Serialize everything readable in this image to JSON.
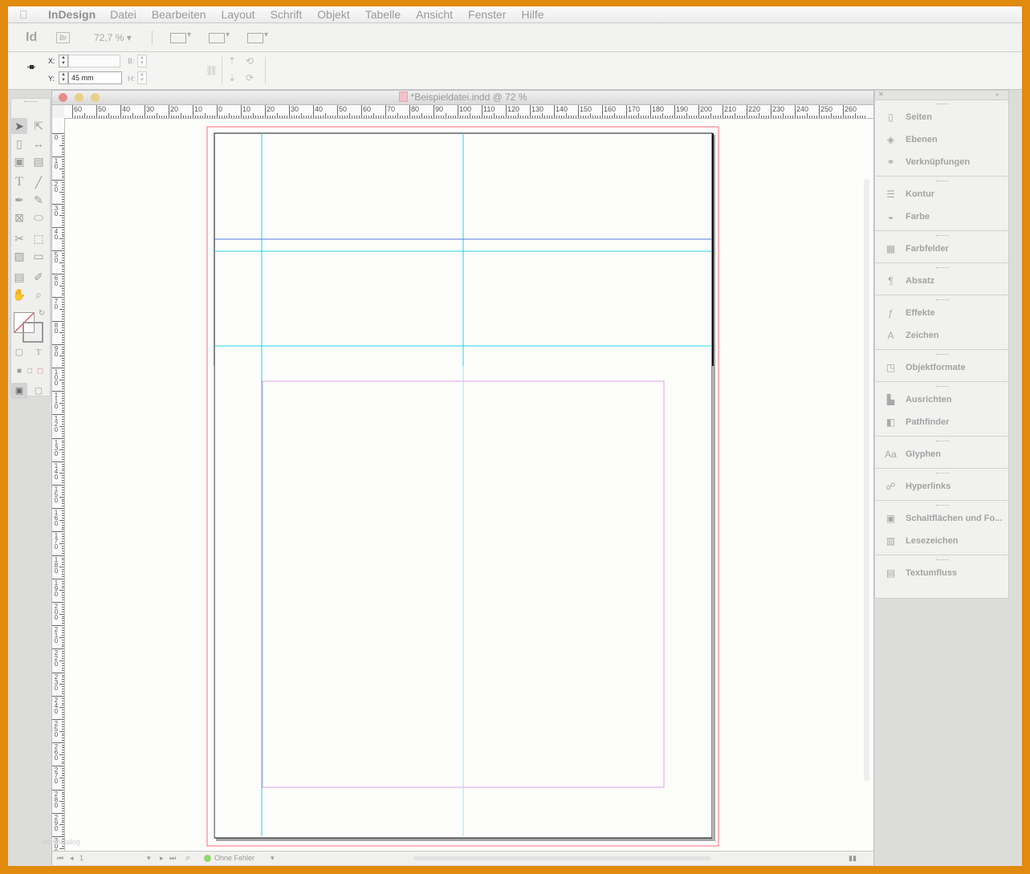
{
  "menu": {
    "app": "InDesign",
    "items": [
      "Datei",
      "Bearbeiten",
      "Layout",
      "Schrift",
      "Objekt",
      "Tabelle",
      "Ansicht",
      "Fenster",
      "Hilfe"
    ]
  },
  "appbar": {
    "logo": "Id",
    "bridge": "Br",
    "zoom": "72,7 %"
  },
  "control": {
    "x_label": "X:",
    "x_value": "",
    "y_label": "Y:",
    "y_value": "45 mm",
    "w_label": "B:",
    "h_label": "H:"
  },
  "document": {
    "title": "*Beispieldatei.indd @ 72 %",
    "h_ruler_labels": [
      "60",
      "50",
      "40",
      "30",
      "20",
      "10",
      "0",
      "10",
      "20",
      "30",
      "40",
      "50",
      "60",
      "70",
      "80",
      "90",
      "100",
      "110",
      "120",
      "130",
      "140",
      "150",
      "160",
      "170",
      "180",
      "190",
      "200",
      "210",
      "220",
      "230",
      "240",
      "250",
      "260"
    ],
    "v_ruler_labels": [
      "0",
      "10",
      "20",
      "30",
      "40",
      "50",
      "60",
      "70",
      "80",
      "90",
      "100",
      "110",
      "120",
      "130",
      "140",
      "150",
      "160",
      "170",
      "180",
      "190",
      "200",
      "210",
      "220",
      "230",
      "240",
      "250",
      "260",
      "270",
      "280",
      "290",
      "300"
    ]
  },
  "status": {
    "page": "1",
    "preflight": "Ohne Fehler"
  },
  "panels": [
    {
      "items": [
        {
          "icon": "pages-icon",
          "label": "Seiten"
        },
        {
          "icon": "layers-icon",
          "label": "Ebenen"
        },
        {
          "icon": "links-icon",
          "label": "Verknüpfungen"
        }
      ]
    },
    {
      "items": [
        {
          "icon": "stroke-icon",
          "label": "Kontur"
        },
        {
          "icon": "color-icon",
          "label": "Farbe"
        }
      ]
    },
    {
      "items": [
        {
          "icon": "swatches-icon",
          "label": "Farbfelder"
        }
      ]
    },
    {
      "items": [
        {
          "icon": "paragraph-icon",
          "label": "Absatz"
        }
      ]
    },
    {
      "items": [
        {
          "icon": "effects-icon",
          "label": "Effekte"
        },
        {
          "icon": "character-icon",
          "label": "Zeichen"
        }
      ]
    },
    {
      "items": [
        {
          "icon": "object-styles-icon",
          "label": "Objektformate"
        }
      ]
    },
    {
      "items": [
        {
          "icon": "align-icon",
          "label": "Ausrichten"
        },
        {
          "icon": "pathfinder-icon",
          "label": "Pathfinder"
        }
      ]
    },
    {
      "items": [
        {
          "icon": "glyphs-icon",
          "label": "Glyphen"
        }
      ]
    },
    {
      "items": [
        {
          "icon": "hyperlinks-icon",
          "label": "Hyperlinks"
        }
      ]
    },
    {
      "items": [
        {
          "icon": "buttons-icon",
          "label": "Schaltflächen und Fo..."
        },
        {
          "icon": "bookmarks-icon",
          "label": "Lesezeichen"
        }
      ]
    },
    {
      "items": [
        {
          "icon": "text-wrap-icon",
          "label": "Textumfluss"
        }
      ]
    }
  ],
  "colors": {
    "border": "#e08a0e",
    "guide": "#22d3f0",
    "margin": "#d9a3e6",
    "bleed": "#ff6b7a",
    "selection": "#4b7bd8"
  }
}
